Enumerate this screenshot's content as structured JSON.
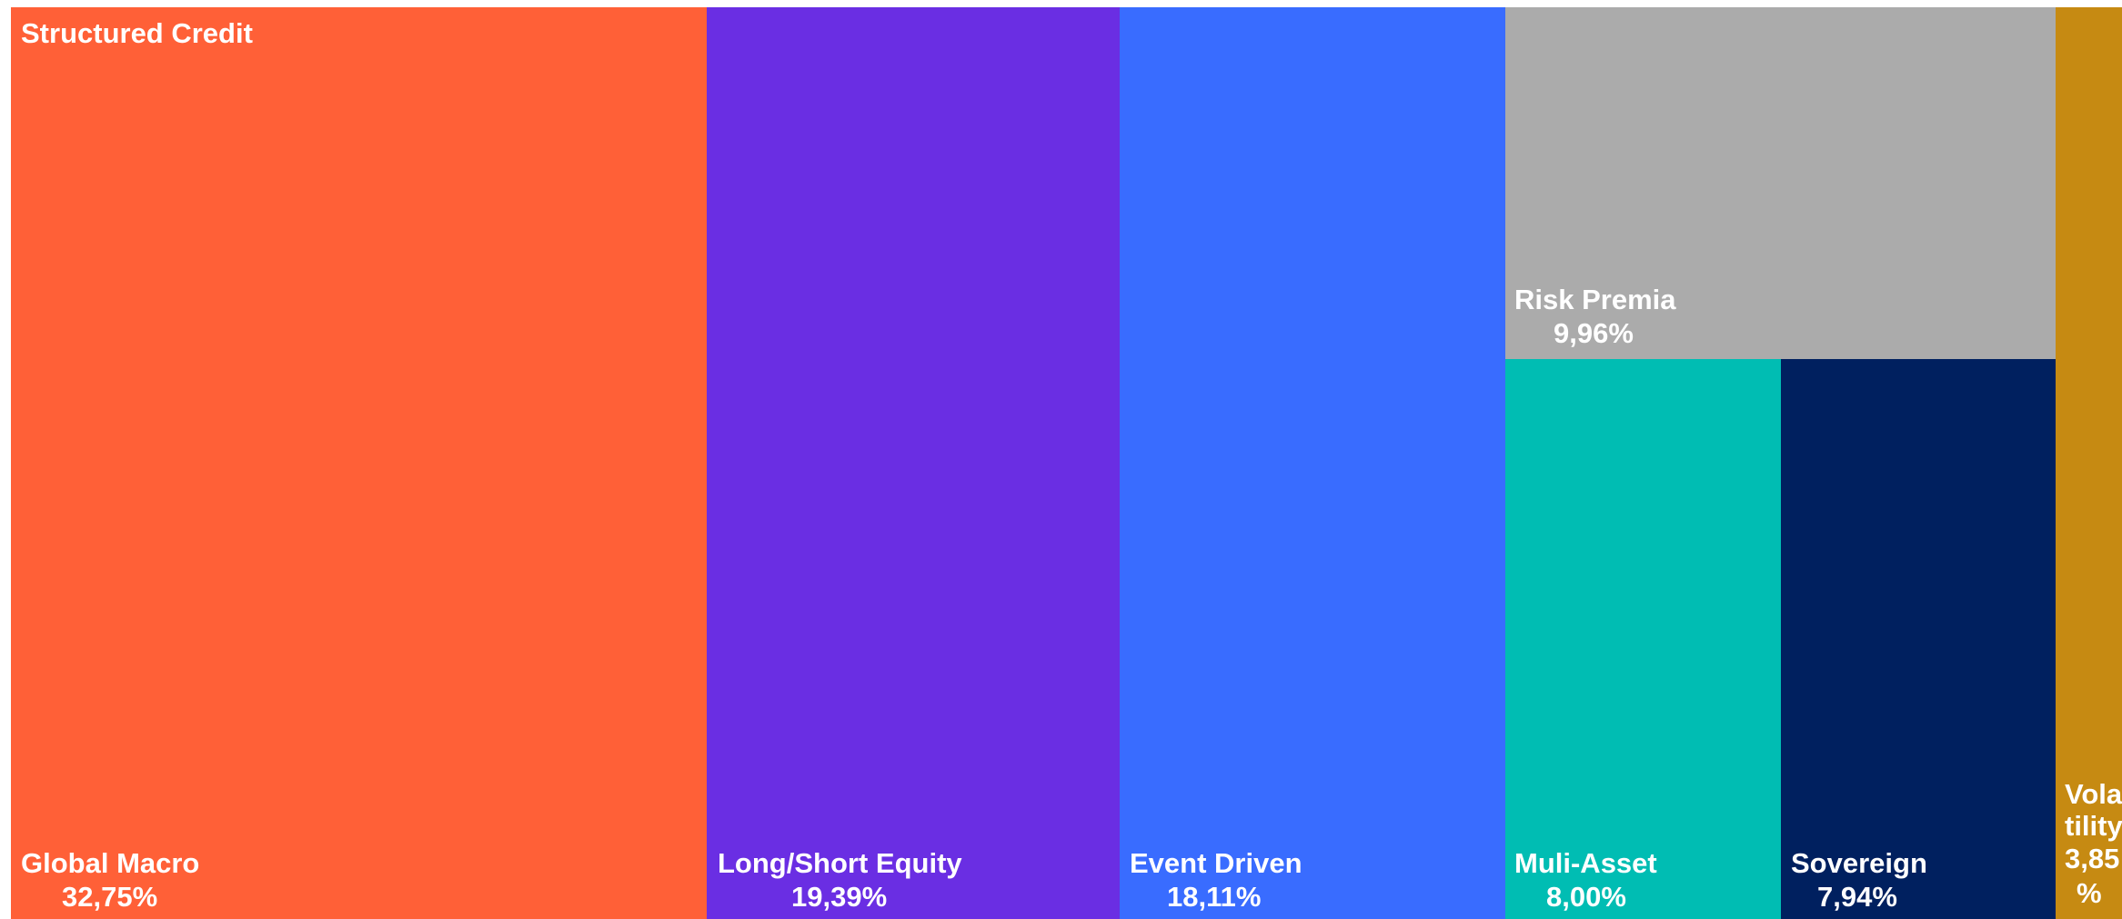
{
  "chart_data": {
    "type": "treemap",
    "title": "Structured Credit",
    "items": [
      {
        "name": "Global Macro",
        "value": 32.75,
        "value_label": "32,75%",
        "color": "#FF6037"
      },
      {
        "name": "Long/Short Equity",
        "value": 19.39,
        "value_label": "19,39%",
        "color": "#6A2EE3"
      },
      {
        "name": "Event Driven",
        "value": 18.11,
        "value_label": "18,11%",
        "color": "#396CFF"
      },
      {
        "name": "Risk Premia",
        "value": 9.96,
        "value_label": "9,96%",
        "color": "#ABABAB"
      },
      {
        "name": "Muli-Asset",
        "value": 8.0,
        "value_label": "8,00%",
        "color": "#00BDB3"
      },
      {
        "name": "Sovereign",
        "value": 7.94,
        "value_label": "7,94%",
        "color": "#00205F"
      },
      {
        "name": "Volatility",
        "value": 3.85,
        "value_label": "3,85%",
        "color": "#C68A12",
        "label_lines": [
          "Vola",
          "tility",
          "3,85",
          "%"
        ]
      }
    ]
  }
}
